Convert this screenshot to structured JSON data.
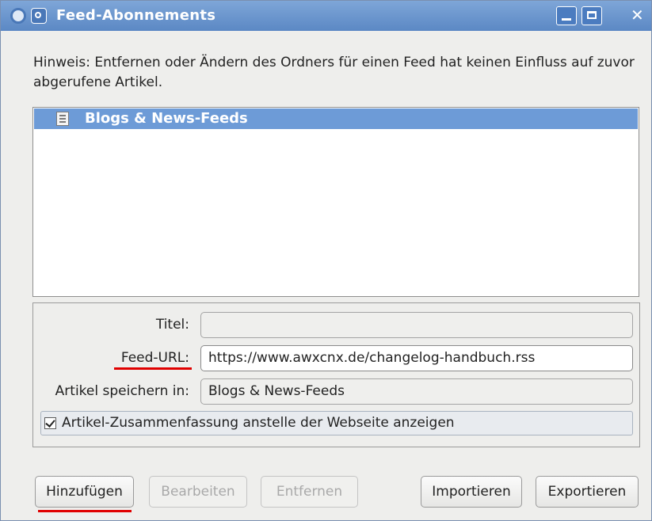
{
  "window": {
    "title": "Feed-Abonnements"
  },
  "hint": "Hinweis: Entfernen oder Ändern des Ordners für einen Feed hat keinen Einfluss auf zuvor abgerufene Artikel.",
  "feed_list": {
    "items": [
      {
        "label": "Blogs & News-Feeds",
        "selected": true,
        "icon": "folder-icon"
      }
    ]
  },
  "form": {
    "title_label": "Titel:",
    "title_value": "",
    "url_label": "Feed-URL:",
    "url_value": "https://www.awxcnx.de/changelog-handbuch.rss",
    "folder_label": "Artikel speichern in:",
    "folder_value": "Blogs & News-Feeds",
    "summary_checkbox_label": "Artikel-Zusammenfassung anstelle der Webseite anzeigen",
    "summary_checked": true
  },
  "buttons": {
    "add": "Hinzufügen",
    "edit": "Bearbeiten",
    "remove": "Entfernen",
    "import": "Importieren",
    "export": "Exportieren"
  },
  "colors": {
    "titlebar": "#5b88c4",
    "selection": "#6d9bd7",
    "annotation_underline": "#e00000"
  }
}
